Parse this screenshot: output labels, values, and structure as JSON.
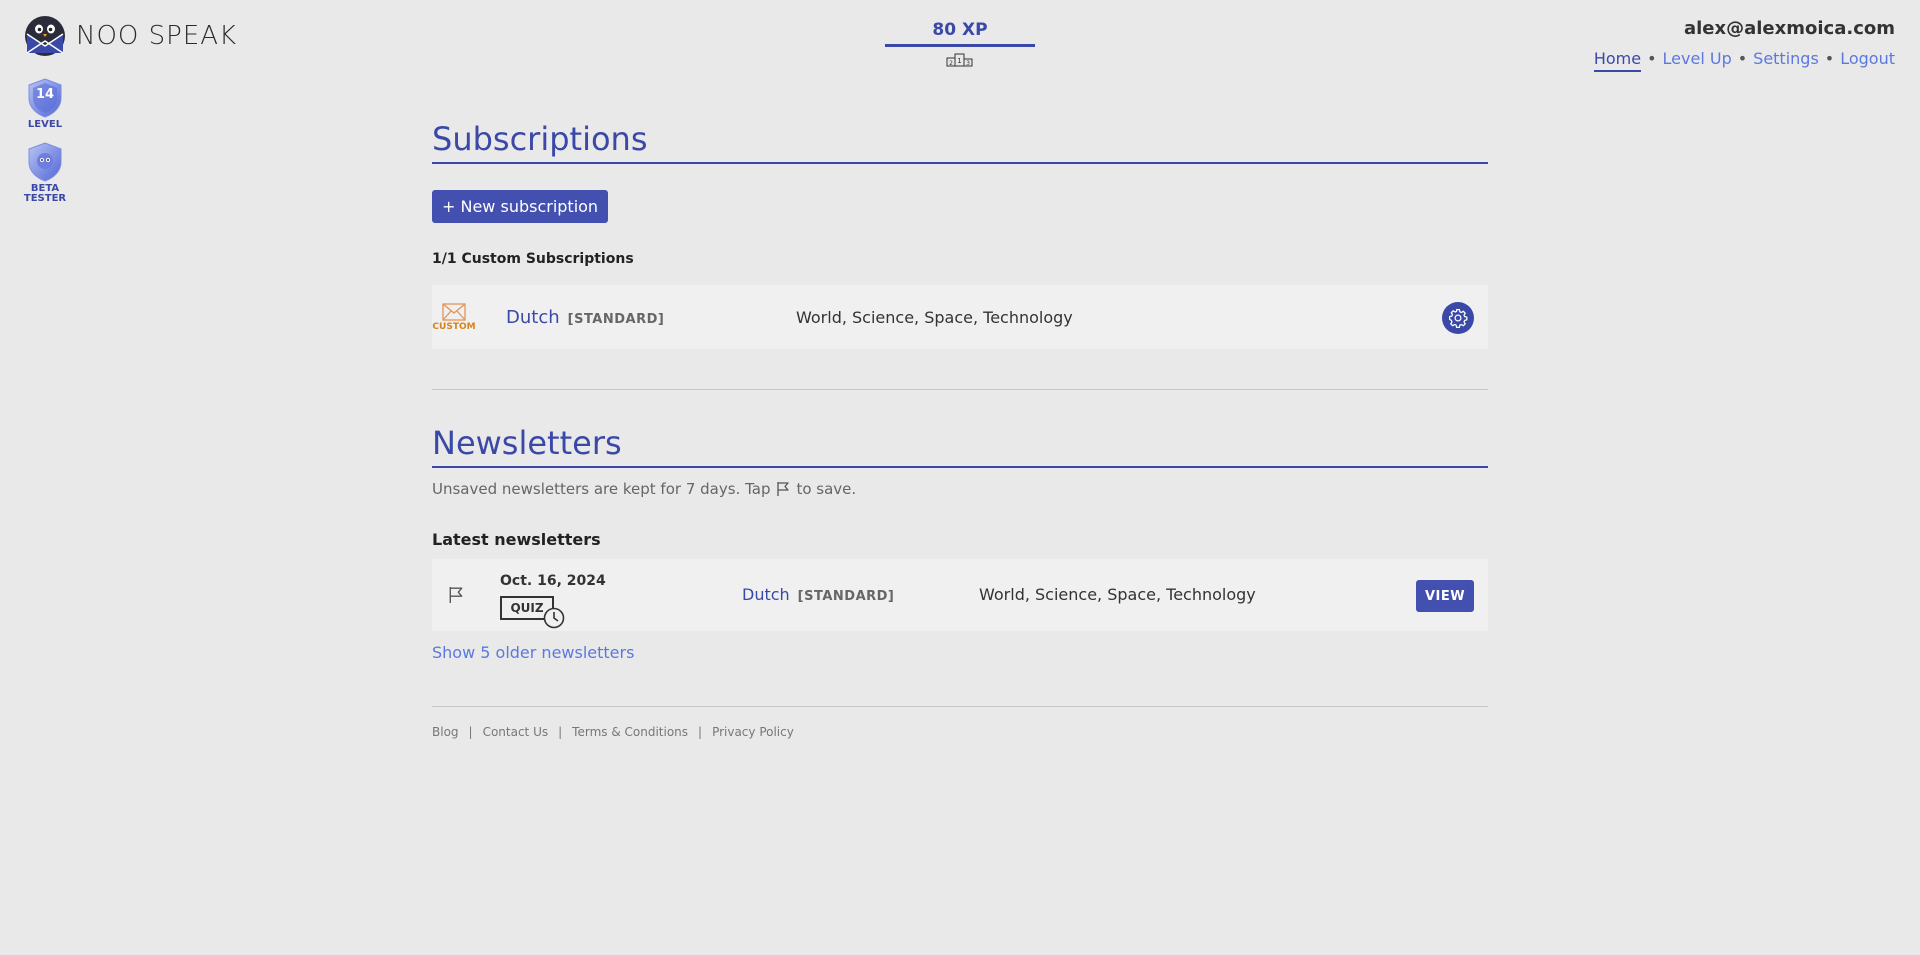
{
  "brand": {
    "name": "NOO SPEAK"
  },
  "badges": [
    {
      "value": "14",
      "label": "LEVEL"
    },
    {
      "label_line1": "BETA",
      "label_line2": "TESTER"
    }
  ],
  "xp": {
    "value": "80 XP",
    "icon": "podium-icon"
  },
  "account": {
    "email": "alex@alexmoica.com",
    "nav": [
      {
        "label": "Home",
        "active": true
      },
      {
        "label": "Level Up"
      },
      {
        "label": "Settings"
      },
      {
        "label": "Logout"
      }
    ]
  },
  "subscriptions": {
    "title": "Subscriptions",
    "new_button": "+ New subscription",
    "count_label": "1/1 Custom Subscriptions",
    "items": [
      {
        "badge": "CUSTOM",
        "language": "Dutch",
        "level": "[STANDARD]",
        "topics": "World, Science, Space, Technology"
      }
    ]
  },
  "newsletters": {
    "title": "Newsletters",
    "note_before": "Unsaved newsletters are kept for 7 days. Tap",
    "note_after": "to save.",
    "latest_title": "Latest newsletters",
    "items": [
      {
        "date": "Oct. 16, 2024",
        "quiz_label": "QUIZ",
        "language": "Dutch",
        "level": "[STANDARD]",
        "topics": "World, Science, Space, Technology",
        "view_label": "VIEW"
      }
    ],
    "older_link": "Show 5 older newsletters"
  },
  "footer": {
    "links": [
      "Blog",
      "Contact Us",
      "Terms & Conditions",
      "Privacy Policy"
    ],
    "separator": "|"
  },
  "colors": {
    "primary": "#3a49a8",
    "button": "#4350b0",
    "link": "#5b78e0",
    "custom_badge": "#d4841a",
    "background": "#e9e9e9"
  }
}
